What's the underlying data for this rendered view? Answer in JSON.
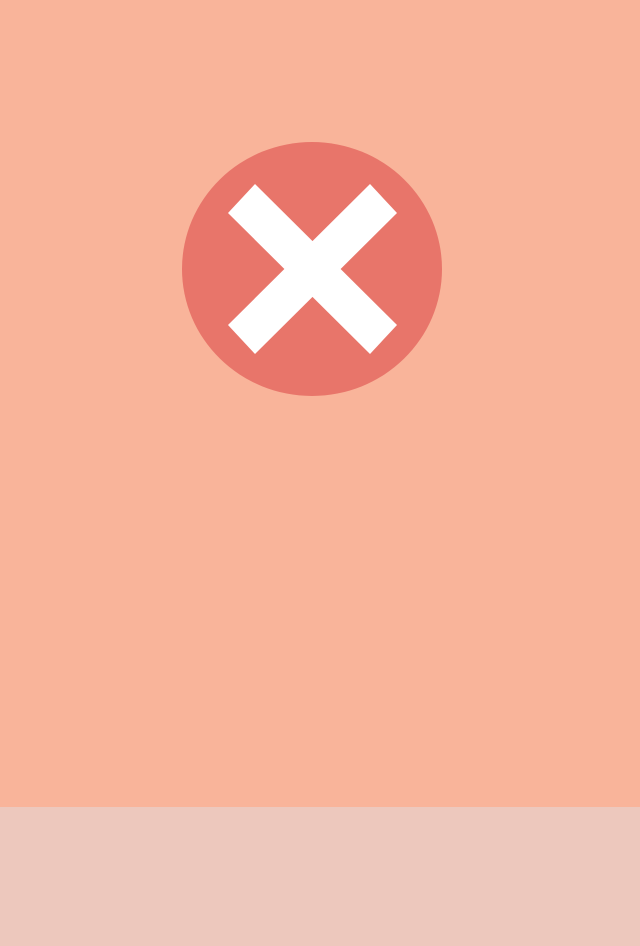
{
  "screen": {
    "background_color": "#F9B49A",
    "bottom_bar_color": "#EDC8BD"
  },
  "error_icon": {
    "icon": "close-icon",
    "circle_color": "#E8756A",
    "cross_color": "#FFFFFF"
  }
}
